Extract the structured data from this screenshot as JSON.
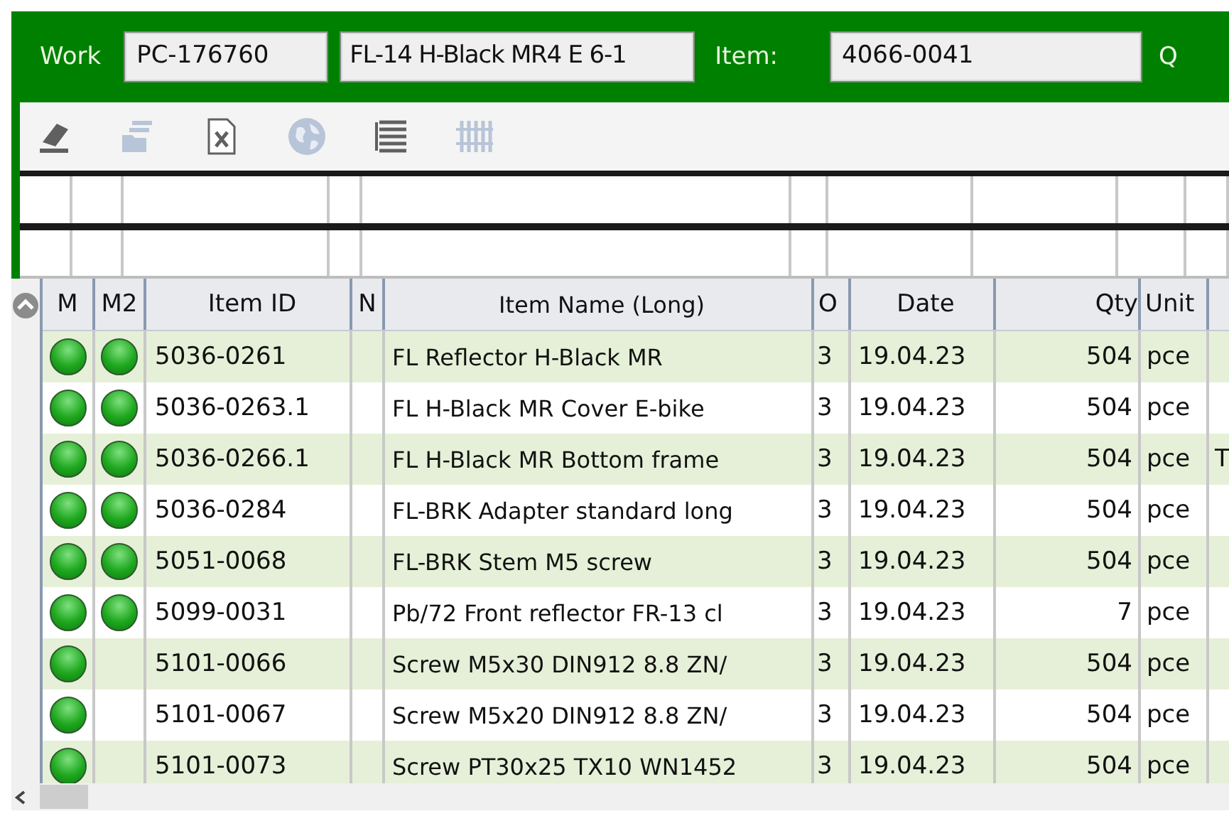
{
  "header": {
    "work_label": "Work",
    "work_order": "PC-176760",
    "work_description": "FL-14 H-Black MR4 E 6-1",
    "item_label": "Item:",
    "item_id": "4066-0041",
    "next_label": "Q"
  },
  "toolbar": [
    {
      "kind": "eraser",
      "disabled": false
    },
    {
      "kind": "documents",
      "disabled": true
    },
    {
      "kind": "excel",
      "disabled": false
    },
    {
      "kind": "globe",
      "disabled": true
    },
    {
      "kind": "list",
      "disabled": false
    },
    {
      "kind": "columns",
      "disabled": true
    }
  ],
  "table": {
    "columns": [
      "M",
      "M2",
      "Item ID",
      "N",
      "Item Name (Long)",
      "O",
      "Date",
      "Qty",
      "Unit"
    ],
    "rows": [
      {
        "m": true,
        "m2": true,
        "item_id": "5036-0261",
        "name": "FL Reflector H-Black MR",
        "op": "3",
        "date": "19.04.23",
        "qty": "504",
        "unit": "pce"
      },
      {
        "m": true,
        "m2": true,
        "item_id": "5036-0263.1",
        "name": "FL H-Black MR Cover E-bike",
        "op": "3",
        "date": "19.04.23",
        "qty": "504",
        "unit": "pce"
      },
      {
        "m": true,
        "m2": true,
        "item_id": "5036-0266.1",
        "name": "FL H-Black MR Bottom frame",
        "op": "3",
        "date": "19.04.23",
        "qty": "504",
        "unit": "pce",
        "column_10": "T"
      },
      {
        "m": true,
        "m2": true,
        "item_id": "5036-0284",
        "name": "FL-BRK Adapter standard long",
        "op": "3",
        "date": "19.04.23",
        "qty": "504",
        "unit": "pce"
      },
      {
        "m": true,
        "m2": true,
        "item_id": "5051-0068",
        "name": "FL-BRK Stem M5 screw",
        "op": "3",
        "date": "19.04.23",
        "qty": "504",
        "unit": "pce"
      },
      {
        "m": true,
        "m2": true,
        "item_id": "5099-0031",
        "name": "Pb/72 Front reflector FR-13 cl",
        "op": "3",
        "date": "19.04.23",
        "qty": "7",
        "unit": "pce"
      },
      {
        "m": true,
        "m2": false,
        "item_id": "5101-0066",
        "name": "Screw M5x30 DIN912 8.8 ZN/",
        "op": "3",
        "date": "19.04.23",
        "qty": "504",
        "unit": "pce"
      },
      {
        "m": true,
        "m2": false,
        "item_id": "5101-0067",
        "name": "Screw M5x20 DIN912 8.8 ZN/",
        "op": "3",
        "date": "19.04.23",
        "qty": "504",
        "unit": "pce"
      },
      {
        "m": true,
        "m2": false,
        "item_id": "5101-0073",
        "name": "Screw PT30x25 TX10 WN1452",
        "op": "3",
        "date": "19.04.23",
        "qty": "504",
        "unit": "pce"
      }
    ]
  }
}
